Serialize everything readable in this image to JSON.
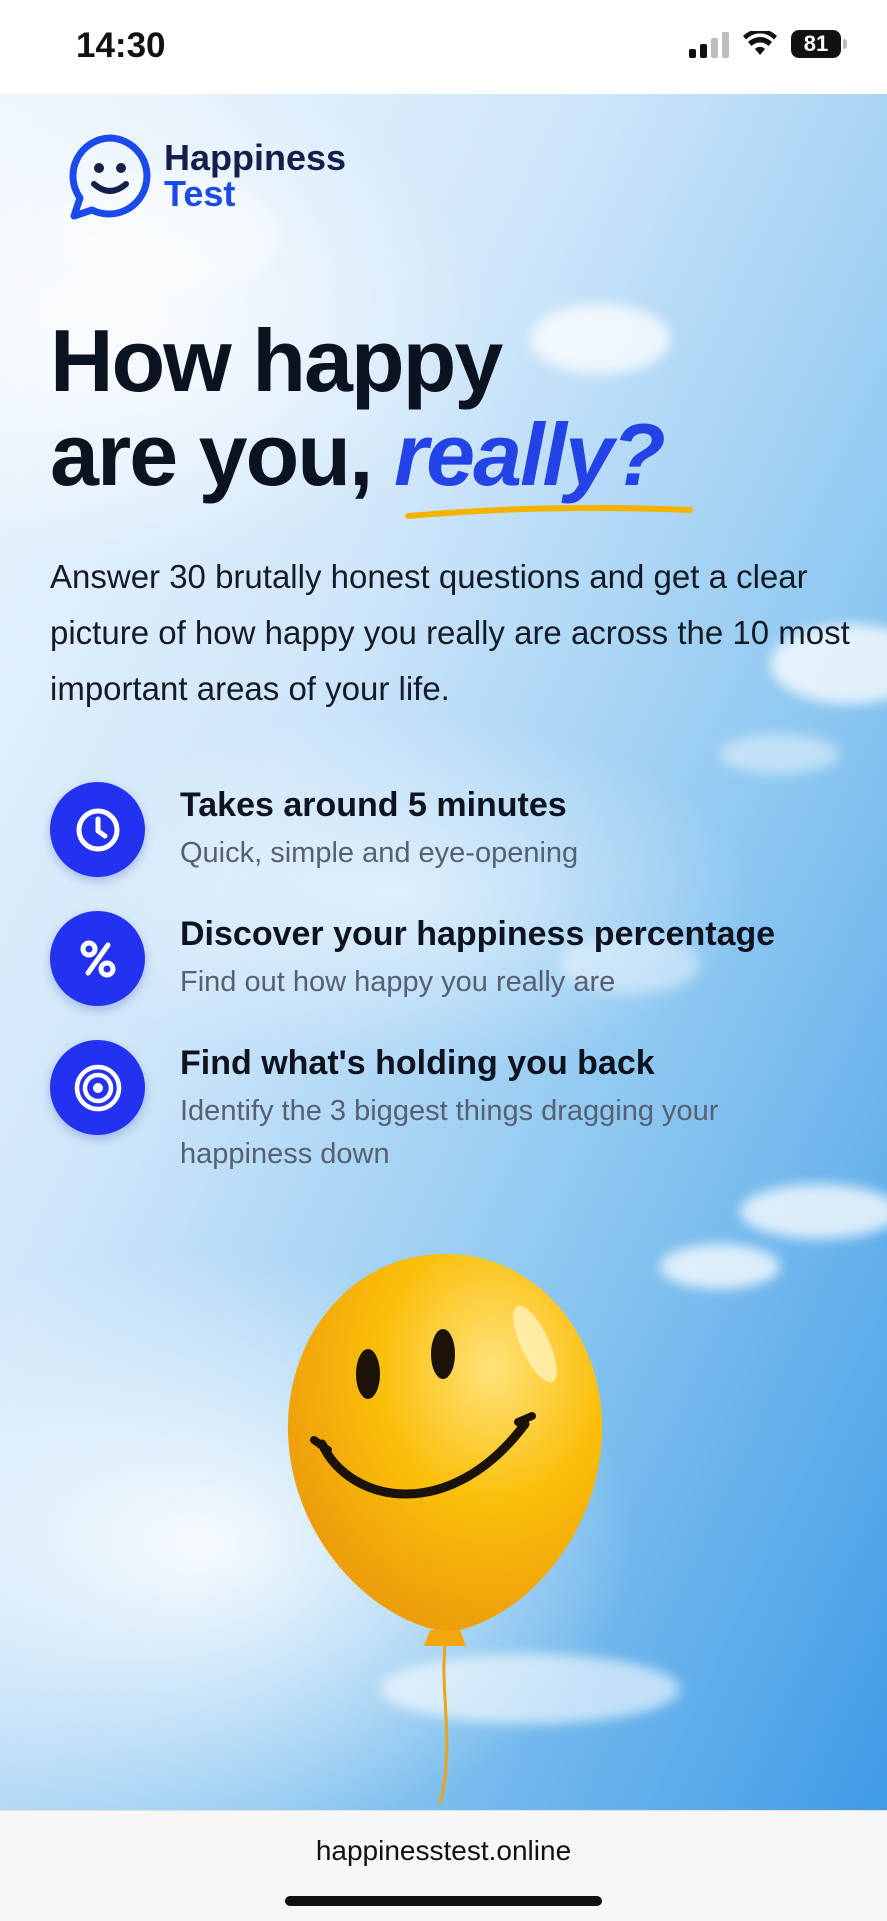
{
  "status_bar": {
    "time": "14:30",
    "battery": "81"
  },
  "brand": {
    "line1": "Happiness",
    "line2": "Test"
  },
  "hero": {
    "headline_line1": "How happy",
    "headline_line2_prefix": "are you,",
    "headline_line2_accent": "really?",
    "intro": "Answer 30 brutally honest questions and get a clear picture of how happy you really are across the 10 most important areas of your life."
  },
  "features": [
    {
      "icon": "clock-icon",
      "title": "Takes around 5 minutes",
      "desc": "Quick, simple and eye-opening"
    },
    {
      "icon": "percent-icon",
      "title": "Discover your happiness percentage",
      "desc": "Find out how happy you really are"
    },
    {
      "icon": "target-icon",
      "title": "Find what's holding you back",
      "desc": "Identify the 3 biggest things dragging your happiness down"
    }
  ],
  "browser": {
    "url": "happinesstest.online"
  },
  "colors": {
    "brand_blue": "#2332f0",
    "accent_blue": "#2443e6",
    "underline_yellow": "#f5b301",
    "balloon_yellow": "#fbbf0a"
  }
}
